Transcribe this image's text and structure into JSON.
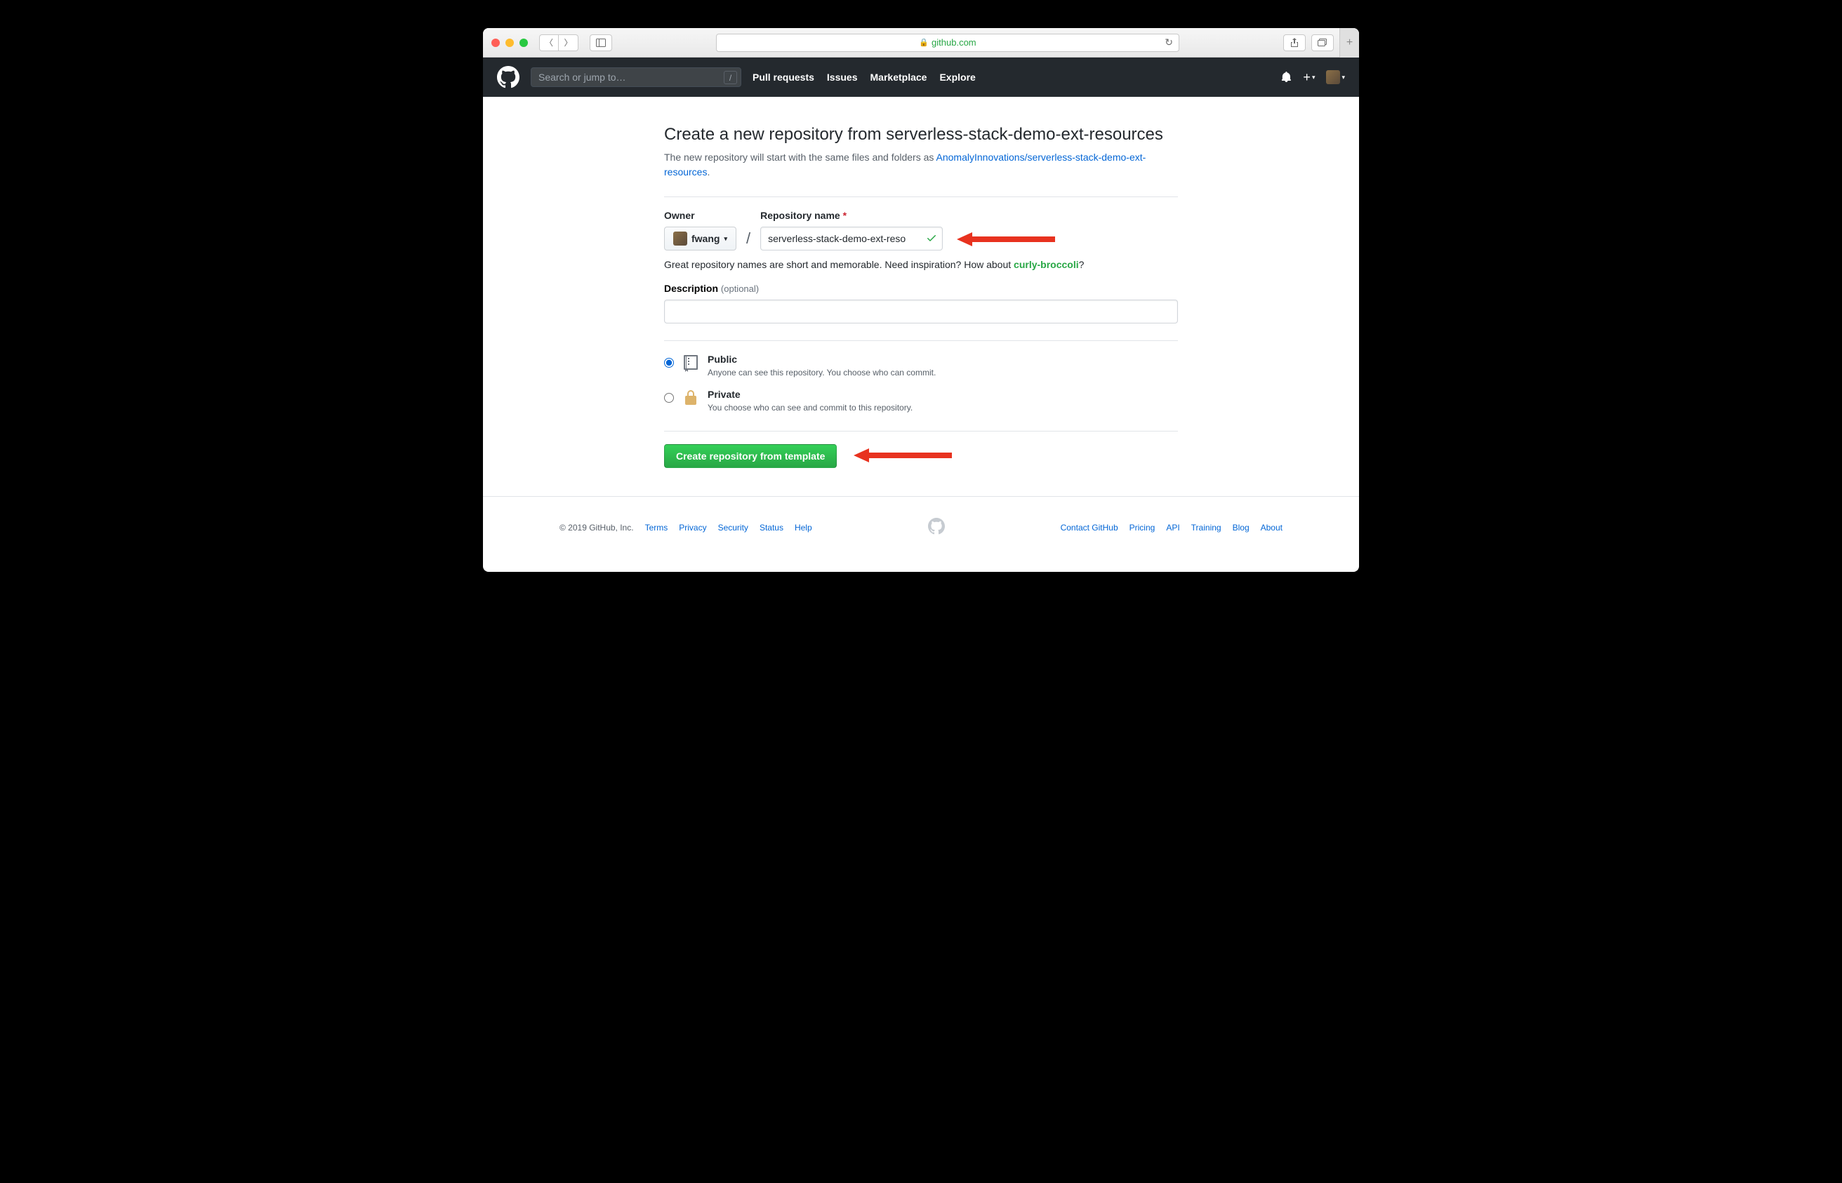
{
  "browser": {
    "url": "github.com",
    "slash_key": "/"
  },
  "gh_nav": {
    "search_placeholder": "Search or jump to…",
    "items": [
      "Pull requests",
      "Issues",
      "Marketplace",
      "Explore"
    ]
  },
  "page": {
    "heading": "Create a new repository from serverless-stack-demo-ext-resources",
    "subhead_prefix": "The new repository will start with the same files and folders as ",
    "subhead_link": "AnomalyInnovations/serverless-stack-demo-ext-resources",
    "subhead_suffix": ".",
    "owner_label": "Owner",
    "owner_value": "fwang",
    "repo_label": "Repository name",
    "repo_value": "serverless-stack-demo-ext-reso",
    "hint_prefix": "Great repository names are short and memorable. Need inspiration? How about ",
    "hint_suggest": "curly-broccoli",
    "hint_suffix": "?",
    "desc_label": "Description",
    "desc_optional": "(optional)",
    "desc_value": "",
    "visibility": {
      "public": {
        "title": "Public",
        "sub": "Anyone can see this repository. You choose who can commit."
      },
      "private": {
        "title": "Private",
        "sub": "You choose who can see and commit to this repository."
      }
    },
    "create_button": "Create repository from template"
  },
  "footer": {
    "copyright": "© 2019 GitHub, Inc.",
    "left": [
      "Terms",
      "Privacy",
      "Security",
      "Status",
      "Help"
    ],
    "right": [
      "Contact GitHub",
      "Pricing",
      "API",
      "Training",
      "Blog",
      "About"
    ]
  }
}
